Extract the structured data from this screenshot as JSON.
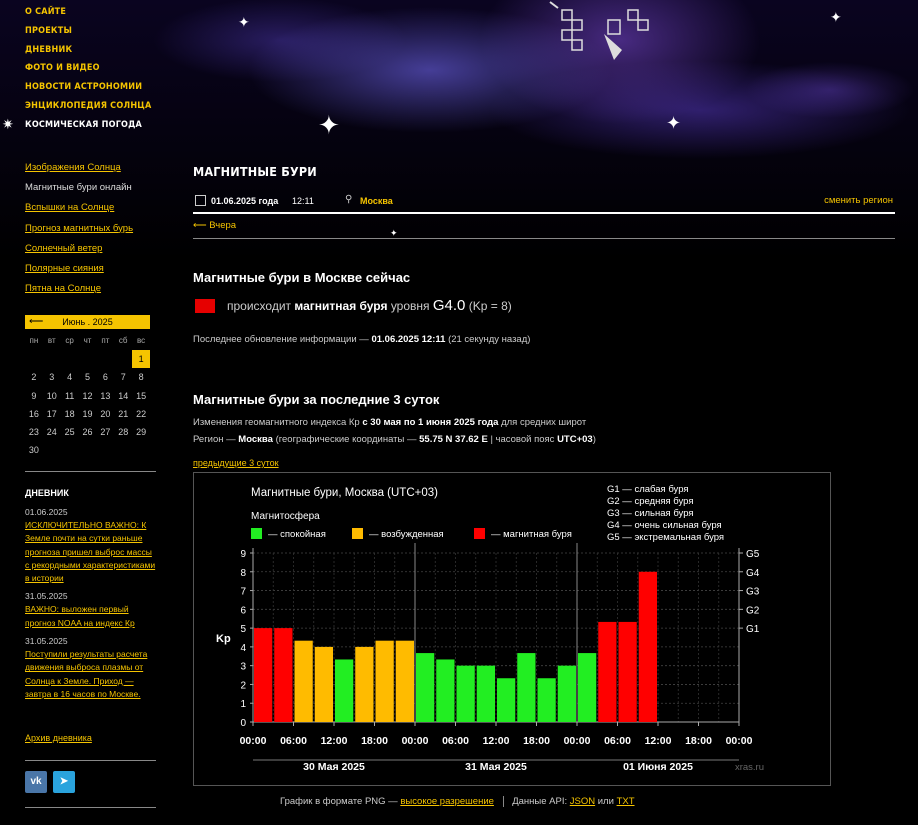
{
  "main_nav": [
    {
      "label": "О сайте"
    },
    {
      "label": "Проекты"
    },
    {
      "label": "Дневник"
    },
    {
      "label": "Фото и видео"
    },
    {
      "label": "Новости астрономии"
    },
    {
      "label": "Энциклопедия Солнца"
    },
    {
      "label": "Космическая погода"
    }
  ],
  "sub_nav": [
    {
      "label": "Изображения Солнца"
    },
    {
      "label": "Магнитные бури онлайн"
    },
    {
      "label": "Вспышки на Солнце"
    },
    {
      "label": "Прогноз магнитных бурь"
    },
    {
      "label": "Солнечный ветер"
    },
    {
      "label": "Полярные сияния"
    },
    {
      "label": "Пятна на Солнце"
    }
  ],
  "calendar": {
    "prev_arrow": "⟵",
    "month": "Июнь . 2025",
    "weekdays": [
      "пн",
      "вт",
      "ср",
      "чт",
      "пт",
      "сб",
      "вс"
    ],
    "leading_blanks": 6,
    "days": [
      "1",
      "2",
      "3",
      "4",
      "5",
      "6",
      "7",
      "8",
      "9",
      "10",
      "11",
      "12",
      "13",
      "14",
      "15",
      "16",
      "17",
      "18",
      "19",
      "20",
      "21",
      "22",
      "23",
      "24",
      "25",
      "26",
      "27",
      "28",
      "29",
      "30"
    ],
    "today": "1"
  },
  "diary": {
    "title": "Дневник",
    "entries": [
      {
        "date": "01.06.2025",
        "text": "ИСКЛЮЧИТЕЛЬНО ВАЖНО: К Земле почти на сутки раньше прогноза пришел выброс массы с рекордными характеристиками в истории"
      },
      {
        "date": "31.05.2025",
        "text": "ВАЖНО: выложен первый прогноз NOAA на индекс Кр"
      },
      {
        "date": "31.05.2025",
        "text": "Поступили результаты расчета движения выброса плазмы от Солнца к Земле. Приход — завтра в 16 часов по Москве."
      }
    ],
    "archive": "Архив дневника"
  },
  "social": {
    "vk": "vk",
    "telegram": "➤"
  },
  "page": {
    "title": "Магнитные бури",
    "date": "01.06.2025 года",
    "time": "12:11",
    "city": "Москва",
    "change_region": "сменить регион",
    "yesterday": "⟵ Вчера"
  },
  "now": {
    "heading": "Магнитные бури в Москве сейчас",
    "pre": "происходит",
    "storm": "магнитная буря",
    "level_pre": "уровня",
    "level": "G4.0",
    "kp": "(Kp = 8)",
    "status_color": "#e60000",
    "update_pre": "Последнее обновление информации —",
    "update_time": "01.06.2025 12:11",
    "update_ago": "(21 секунду назад)"
  },
  "history": {
    "heading": "Магнитные бури за последние 3 суток",
    "line1_pre": "Изменения геомагнитного индекса Кр",
    "line1_range": "с 30 мая по 1 июня 2025 года",
    "line1_post": "для средних широт",
    "line2_pre": "Регион —",
    "line2_city": "Москва",
    "line2_mid": "(географические координаты —",
    "line2_coords": "55.75 N 37.62 E",
    "line2_mid2": "| часовой пояс",
    "line2_tz": "UTC+03",
    "line2_end": ")",
    "prev_link": "предыдущие 3 суток"
  },
  "chart_data": {
    "type": "bar",
    "title": "Магнитные бури, Москва (UTC+03)",
    "legend_title": "Магнитосфера",
    "legend": [
      {
        "name": "— спокойная",
        "color": "#22ee22"
      },
      {
        "name": "— возбужденная",
        "color": "#ffbb00"
      },
      {
        "name": "— магнитная буря",
        "color": "#ff0000"
      }
    ],
    "g_legend": [
      "G1 — слабая буря",
      "G2 — средняя буря",
      "G3 — сильная буря",
      "G4 — очень сильная буря",
      "G5 — экстремальная буря"
    ],
    "ylabel": "Kp",
    "ylim": [
      0,
      9
    ],
    "yticks": [
      "0",
      "1",
      "2",
      "3",
      "4",
      "5",
      "6",
      "7",
      "8",
      "9"
    ],
    "g_levels": [
      {
        "label": "G1",
        "kp": 5
      },
      {
        "label": "G2",
        "kp": 6
      },
      {
        "label": "G3",
        "kp": 7
      },
      {
        "label": "G4",
        "kp": 8
      },
      {
        "label": "G5",
        "kp": 9
      }
    ],
    "x_ticks": [
      "00:00",
      "06:00",
      "12:00",
      "18:00",
      "00:00",
      "06:00",
      "12:00",
      "18:00",
      "00:00",
      "06:00",
      "12:00",
      "18:00",
      "00:00"
    ],
    "days": [
      "30 Мая 2025",
      "31 Мая 2025",
      "01 Июня 2025"
    ],
    "watermark": "xras.ru",
    "values": [
      5.0,
      5.0,
      4.33,
      4.0,
      3.33,
      4.0,
      4.33,
      4.33,
      3.67,
      3.33,
      3.0,
      3.0,
      2.33,
      3.67,
      2.33,
      3.0,
      3.67,
      5.33,
      5.33,
      8.0
    ],
    "levels": [
      "storm",
      "storm",
      "active",
      "active",
      "quiet",
      "active",
      "active",
      "active",
      "quiet",
      "quiet",
      "quiet",
      "quiet",
      "quiet",
      "quiet",
      "quiet",
      "quiet",
      "quiet",
      "storm",
      "storm",
      "storm"
    ],
    "colors": {
      "quiet": "#22ee22",
      "active": "#ffbb00",
      "storm": "#ff0000"
    },
    "grid": true
  },
  "footer": {
    "png_pre": "График в формате PNG —",
    "png_link": "высокое разрешение",
    "api_pre": "Данные API:",
    "json": "JSON",
    "or": "или",
    "txt": "TXT"
  }
}
